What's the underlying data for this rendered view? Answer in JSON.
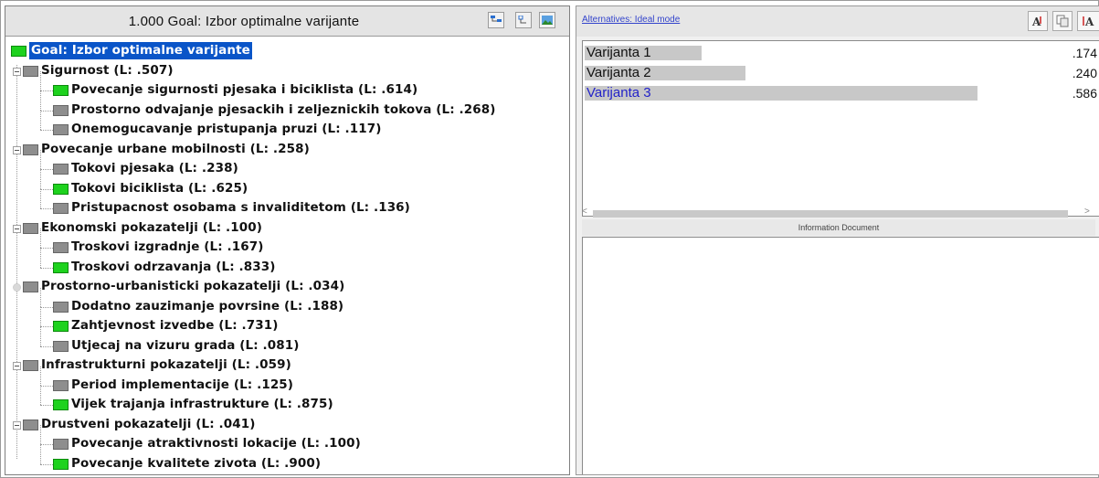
{
  "left_pane": {
    "title": "1.000  Goal: Izbor optimalne varijante",
    "goal_label": "Goal: Izbor optimalne varijante",
    "tree": [
      {
        "label": "Sigurnost (L: .507)",
        "level": 1,
        "color": "gray",
        "toggle": "minus"
      },
      {
        "label": "Povecanje sigurnosti pjesaka i biciklista (L: .614)",
        "level": 2,
        "color": "green"
      },
      {
        "label": "Prostorno odvajanje pjesackih i zeljeznickih tokova (L: .268)",
        "level": 2,
        "color": "gray"
      },
      {
        "label": "Onemogucavanje pristupanja pruzi (L: .117)",
        "level": 2,
        "color": "gray"
      },
      {
        "label": "Povecanje urbane mobilnosti (L: .258)",
        "level": 1,
        "color": "gray",
        "toggle": "minus"
      },
      {
        "label": "Tokovi pjesaka (L: .238)",
        "level": 2,
        "color": "gray"
      },
      {
        "label": "Tokovi biciklista (L: .625)",
        "level": 2,
        "color": "green"
      },
      {
        "label": "Pristupacnost osobama s invaliditetom (L: .136)",
        "level": 2,
        "color": "gray"
      },
      {
        "label": "Ekonomski pokazatelji (L: .100)",
        "level": 1,
        "color": "gray",
        "toggle": "minus"
      },
      {
        "label": "Troskovi izgradnje (L: .167)",
        "level": 2,
        "color": "gray"
      },
      {
        "label": "Troskovi odrzavanja (L: .833)",
        "level": 2,
        "color": "green"
      },
      {
        "label": "Prostorno-urbanisticki pokazatelji (L: .034)",
        "level": 1,
        "color": "gray",
        "toggle": "dot"
      },
      {
        "label": "Dodatno zauzimanje povrsine (L: .188)",
        "level": 2,
        "color": "gray"
      },
      {
        "label": "Zahtjevnost izvedbe (L: .731)",
        "level": 2,
        "color": "green"
      },
      {
        "label": "Utjecaj na vizuru grada (L: .081)",
        "level": 2,
        "color": "gray"
      },
      {
        "label": "Infrastrukturni pokazatelji (L: .059)",
        "level": 1,
        "color": "gray",
        "toggle": "minus"
      },
      {
        "label": "Period implementacije (L: .125)",
        "level": 2,
        "color": "gray"
      },
      {
        "label": "Vijek trajanja infrastrukture (L: .875)",
        "level": 2,
        "color": "green"
      },
      {
        "label": "Drustveni pokazatelji (L: .041)",
        "level": 1,
        "color": "gray",
        "toggle": "minus"
      },
      {
        "label": "Povecanje atraktivnosti lokacije (L: .100)",
        "level": 2,
        "color": "gray"
      },
      {
        "label": "Povecanje kvalitete zivota (L: .900)",
        "level": 2,
        "color": "green"
      }
    ],
    "toolbar_icons": [
      "tree-view-icon",
      "collapse-icon",
      "image-icon"
    ]
  },
  "right_pane": {
    "alternatives_link": "Alternatives: Ideal mode",
    "alternatives": [
      {
        "name": "Varijanta 1",
        "value": ".174",
        "score": 0.174,
        "selected": false
      },
      {
        "name": "Varijanta 2",
        "value": ".240",
        "score": 0.24,
        "selected": false
      },
      {
        "name": "Varijanta 3",
        "value": ".586",
        "score": 0.586,
        "selected": true
      }
    ],
    "info_label": "Information Document",
    "toolbar_icons": [
      "font-icon",
      "copy-icon",
      "text-size-icon"
    ]
  },
  "colors": {
    "node_green": "#1ed21e",
    "node_gray": "#8e8e8e",
    "selection_blue": "#0a55c8",
    "selected_alt_text": "#2222c8"
  }
}
